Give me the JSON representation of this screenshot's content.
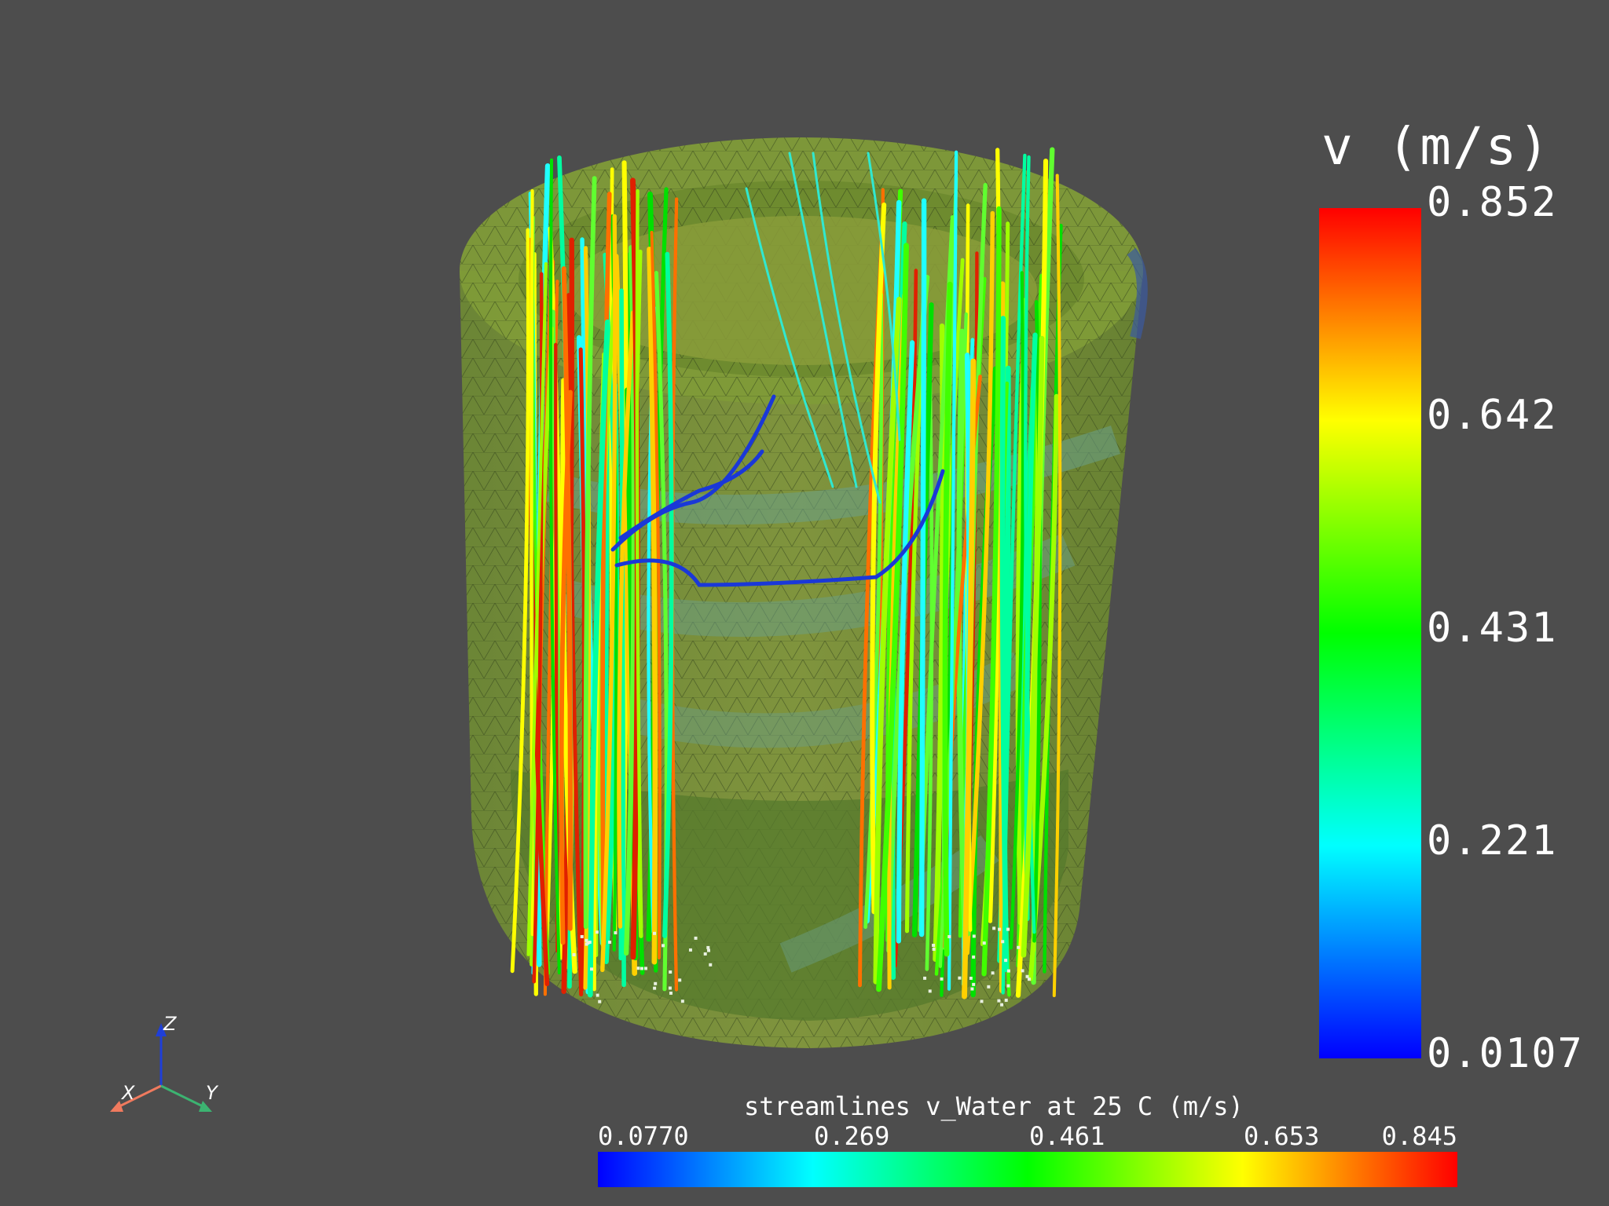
{
  "scene": {
    "background": "#4d4d4d",
    "object": "transparent cylindrical tank mesh with helical coil and streamlines",
    "mesh_color": "#7a9a3a"
  },
  "colorbar_vertical": {
    "title": "v (m/s)",
    "ticks": [
      "0.852",
      "0.642",
      "0.431",
      "0.221",
      "0.0107"
    ],
    "range": [
      0.0107,
      0.852
    ],
    "colormap": "rainbow"
  },
  "colorbar_horizontal": {
    "title": "streamlines v_Water at 25 C (m/s)",
    "ticks": [
      "0.0770",
      "0.269",
      "0.461",
      "0.653",
      "0.845"
    ],
    "range": [
      0.077,
      0.845
    ],
    "colormap": "rainbow"
  },
  "axes_triad": {
    "x_label": "X",
    "y_label": "Y",
    "z_label": "Z",
    "x_color": "#f07a5e",
    "y_color": "#3cb371",
    "z_color": "#1f3fd8"
  }
}
